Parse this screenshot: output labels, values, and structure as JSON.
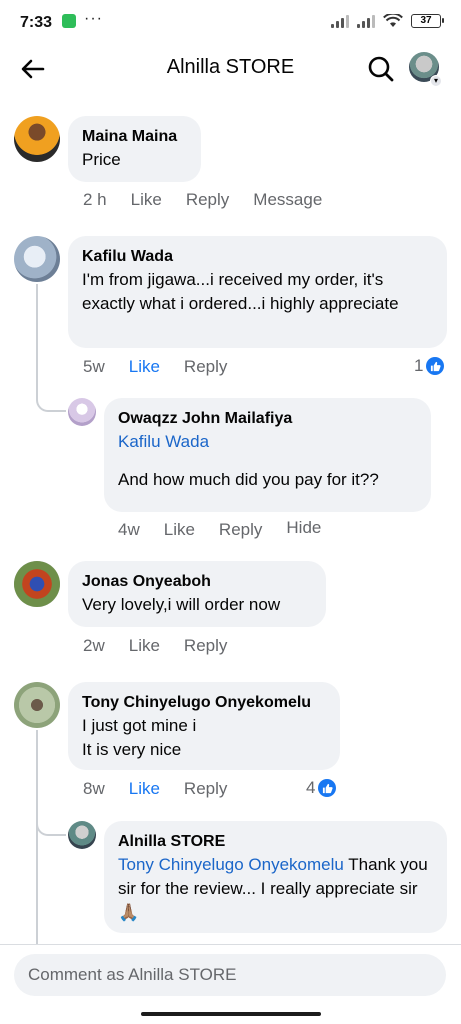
{
  "status": {
    "time": "7:33",
    "dots": "···",
    "battery": "37"
  },
  "header": {
    "title": "Alnilla STORE"
  },
  "comments": [
    {
      "name": "Maina Maina",
      "text": "Price",
      "time": "2 h",
      "like": "Like",
      "reply": "Reply",
      "message": "Message"
    },
    {
      "name": "Kafilu Wada",
      "text": "I'm from jigawa...i received my order, it's exactly what i ordered...i highly appreciate",
      "time": "5w",
      "like": "Like",
      "reply": "Reply",
      "reactions": "1"
    },
    {
      "name": "Owaqzz John Mailafiya",
      "mention": "Kafilu Wada",
      "text": "And how much did you pay for it??",
      "time": "4w",
      "like": "Like",
      "reply": "Reply",
      "hide": "Hide"
    },
    {
      "name": "Jonas Onyeaboh",
      "text": "Very lovely,i will order now",
      "time": "2w",
      "like": "Like",
      "reply": "Reply"
    },
    {
      "name": "Tony Chinyelugo Onyekomelu",
      "text": "I just got mine i\nIt is very nice",
      "time": "8w",
      "like": "Like",
      "reply": "Reply",
      "reactions": "4"
    },
    {
      "name": "Alnilla STORE",
      "mention": "Tony Chinyelugo Onyekomelu",
      "text": " Thank you sir for the review... I really appreciate sir🙏🏽"
    }
  ],
  "composer": {
    "placeholder": "Comment as Alnilla STORE"
  },
  "colors": {
    "accent": "#1877f2",
    "bubble": "#f0f2f5",
    "muted": "#65676b"
  },
  "icons": [
    "back-arrow-icon",
    "search-icon",
    "like-reaction-icon"
  ]
}
